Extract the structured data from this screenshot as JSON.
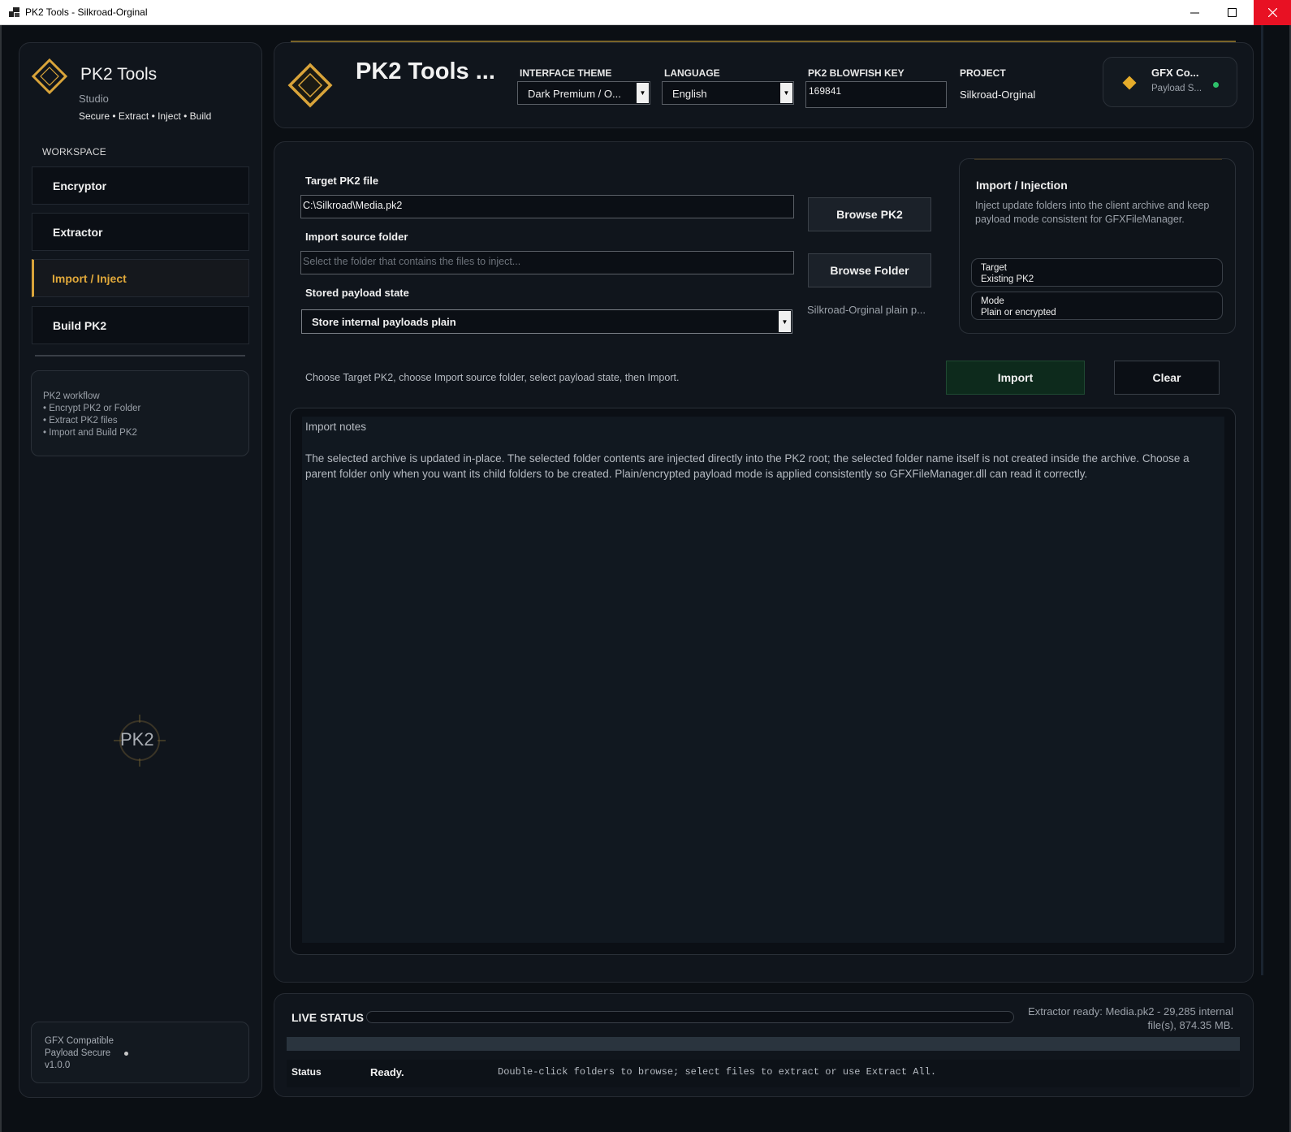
{
  "window": {
    "title": "PK2 Tools - Silkroad-Orginal",
    "min_icon": "minimize-icon",
    "max_icon": "maximize-icon",
    "close_icon": "close-icon"
  },
  "sidebar": {
    "brand_title": "PK2 Tools",
    "brand_sub": "Studio",
    "brand_tag": "Secure • Extract • Inject • Build",
    "workspace_label": "WORKSPACE",
    "items": [
      {
        "label": "Encryptor"
      },
      {
        "label": "Extractor"
      },
      {
        "label": "Import / Inject"
      },
      {
        "label": "Build PK2"
      }
    ],
    "workflow": {
      "title": "PK2 workflow",
      "lines": [
        "• Encrypt PK2 or Folder",
        "• Extract PK2 files",
        "• Import and Build PK2"
      ]
    },
    "seal_text": "PK2",
    "footer": {
      "line1": "GFX Compatible",
      "line2": "Payload Secure",
      "line3": "v1.0.0"
    }
  },
  "header": {
    "title": "PK2 Tools ...",
    "theme_label": "INTERFACE THEME",
    "theme_value": "Dark Premium / O...",
    "language_label": "LANGUAGE",
    "language_value": "English",
    "key_label": "PK2 BLOWFISH KEY",
    "key_value": "169841",
    "project_label": "PROJECT",
    "project_value": "Silkroad-Orginal",
    "badge_title": "GFX Co...",
    "badge_sub": "Payload S..."
  },
  "main": {
    "target_label": "Target PK2 file",
    "target_value": "C:\\Silkroad\\Media.pk2",
    "browse_pk2": "Browse PK2",
    "source_label": "Import source folder",
    "source_placeholder": "Select the folder that contains the files to inject...",
    "browse_folder": "Browse Folder",
    "payload_label": "Stored payload state",
    "payload_value": "Store internal payloads plain",
    "payload_hint": "Silkroad-Orginal plain p...",
    "info_title": "Import / Injection",
    "info_desc": "Inject update folders into the client archive and keep payload mode consistent for GFXFileManager.",
    "pill_target_k": "Target",
    "pill_target_v": "Existing PK2",
    "pill_mode_k": "Mode",
    "pill_mode_v": "Plain or encrypted",
    "instructions": "Choose Target PK2, choose Import source folder, select payload state, then Import.",
    "import_btn": "Import",
    "clear_btn": "Clear",
    "notes_title": "Import notes",
    "notes_body": "The selected archive is updated in-place. The selected folder contents are injected directly into the PK2 root; the selected folder name itself is not created inside the archive. Choose a parent folder only when you want its child folders to be created. Plain/encrypted payload mode is applied consistently so GFXFileManager.dll can read it correctly."
  },
  "status": {
    "live_label": "LIVE STATUS",
    "progress": 0,
    "extractor_msg": "Extractor ready: Media.pk2 - 29,285 internal file(s), 874.35 MB.",
    "status_key": "Status",
    "status_val": "Ready.",
    "status_hint": "Double-click folders to browse; select files to extract or use Extract All."
  },
  "colors": {
    "accent_gold": "#d9a43a",
    "ok_green": "#2ec06a",
    "bg": "#0b0f14"
  }
}
